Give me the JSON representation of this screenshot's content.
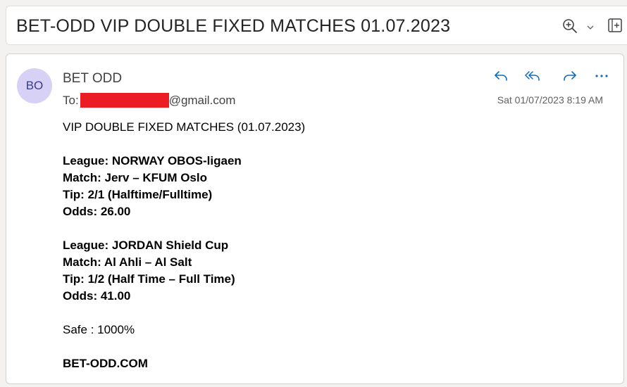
{
  "subject": "BET-ODD VIP DOUBLE FIXED MATCHES 01.07.2023",
  "toolbar": {
    "zoom_icon": "zoom-in-icon",
    "chevron_icon": "chevron-down-icon",
    "popout_icon": "open-in-new-window-icon"
  },
  "message": {
    "avatar_initials": "BO",
    "avatar_color": "#d6d1f5",
    "sender": "BET ODD",
    "to_label": "To:",
    "to_domain": "@gmail.com",
    "redaction_color": "#ec1c24",
    "date": "Sat 01/07/2023 8:19 AM",
    "actions": [
      "reply-icon",
      "reply-all-icon",
      "forward-icon",
      "more-icon"
    ],
    "accent": "#0f6cbd",
    "body": {
      "heading": "VIP DOUBLE FIXED MATCHES (01.07.2023)",
      "match1": {
        "league": "League: NORWAY OBOS-ligaen",
        "match": "Match: Jerv – KFUM Oslo",
        "tip": "Tip: 2/1 (Halftime/Fulltime)",
        "odds": "Odds: 26.00"
      },
      "match2": {
        "league": "League: JORDAN Shield Cup",
        "match": "Match: Al Ahli – Al Salt",
        "tip": "Tip: 1/2 (Half Time – Full Time)",
        "odds": "Odds: 41.00"
      },
      "safe": "Safe : 1000%",
      "footer": "BET-ODD.COM"
    }
  }
}
